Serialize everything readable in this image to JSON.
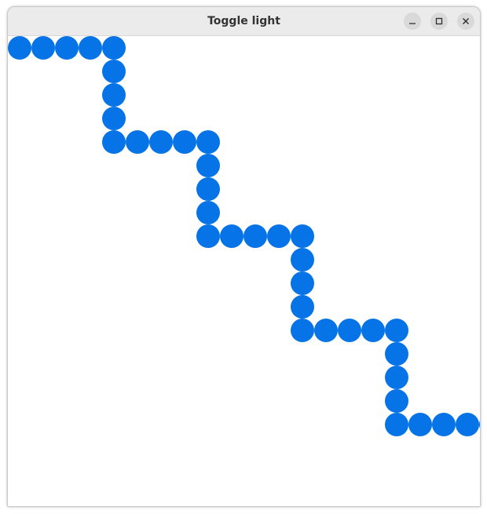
{
  "window": {
    "title": "Toggle light"
  },
  "icons": {
    "minimize": "minimize-icon",
    "maximize": "maximize-icon",
    "close": "close-icon"
  },
  "colors": {
    "light_on": "#0673e6"
  }
}
